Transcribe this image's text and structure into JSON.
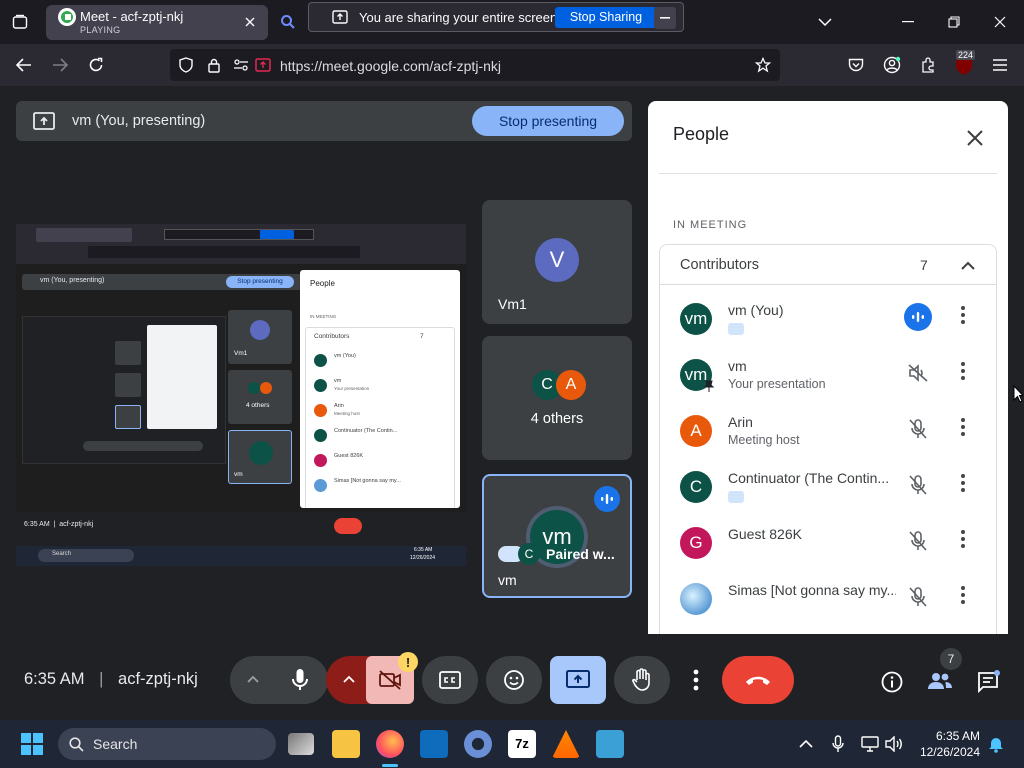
{
  "browser": {
    "tab_title": "Meet - acf-zptj-nkj",
    "tab_status": "PLAYING",
    "share_notice": "You are sharing your entire screen.",
    "stop_sharing_label": "Stop Sharing",
    "url": "https://meet.google.com/acf-zptj-nkj",
    "extension_badge": "224"
  },
  "meet": {
    "presenting_label": "vm (You, presenting)",
    "stop_presenting_label": "Stop presenting",
    "tiles": [
      {
        "initial": "V",
        "name": "Vm1"
      },
      {
        "initials": [
          "C",
          "A"
        ],
        "label": "4 others"
      },
      {
        "initial": "vm",
        "name": "vm",
        "caption": "Paired w...",
        "chip_initial": "C"
      }
    ]
  },
  "people_panel": {
    "title": "People",
    "section": "IN MEETING",
    "group_label": "Contributors",
    "group_count": "7",
    "participants": [
      {
        "initial": "vm",
        "name": "vm (You)",
        "sub": "",
        "color": "#0d5246",
        "mic": "speaking"
      },
      {
        "initial": "vm",
        "name": "vm",
        "sub": "Your presentation",
        "color": "#0d5246",
        "mic": "muted-volume"
      },
      {
        "initial": "A",
        "name": "Arin",
        "sub": "Meeting host",
        "color": "#e8590c",
        "mic": "muted"
      },
      {
        "initial": "C",
        "name": "Continuator (The Contin...",
        "sub": "",
        "color": "#0d5246",
        "mic": "muted"
      },
      {
        "initial": "G",
        "name": "Guest 826K",
        "sub": "",
        "color": "#c2185b",
        "mic": "muted"
      },
      {
        "initial": "",
        "name": "Simas [Not gonna say my...",
        "sub": "",
        "color": "#5b9bd5",
        "mic": "muted"
      }
    ]
  },
  "controls": {
    "time": "6:35 AM",
    "meeting_code": "acf-zptj-nkj",
    "people_count": "7",
    "camera_warning": "!"
  },
  "taskbar": {
    "search_placeholder": "Search",
    "time": "6:35 AM",
    "date": "12/26/2024"
  },
  "preview": {
    "presenting_label": "vm (You, presenting)",
    "stop_presenting_label": "Stop presenting",
    "panel_title": "People",
    "section": "IN MEETING",
    "group_label": "Contributors",
    "group_count": "7",
    "names": [
      "vm (You)",
      "vm",
      "Arin",
      "Continuator (The Contin...",
      "Guest 826K",
      "Simas [Not gonna say my..."
    ],
    "subs": [
      "",
      "Your presentation",
      "Meeting host",
      "",
      "",
      ""
    ],
    "tile_names": [
      "Vm1",
      "4 others",
      "vm"
    ],
    "time_code": "6:35 AM  |  acf-zptj-nkj",
    "search": "Search",
    "task_time": "6:35 AM",
    "task_date": "12/26/2024"
  },
  "colors": {
    "accent_blue": "#8ab4f8",
    "speaking_blue": "#1a73e8",
    "end_call_red": "#ea4335",
    "present_active": "#a8c7fa"
  }
}
